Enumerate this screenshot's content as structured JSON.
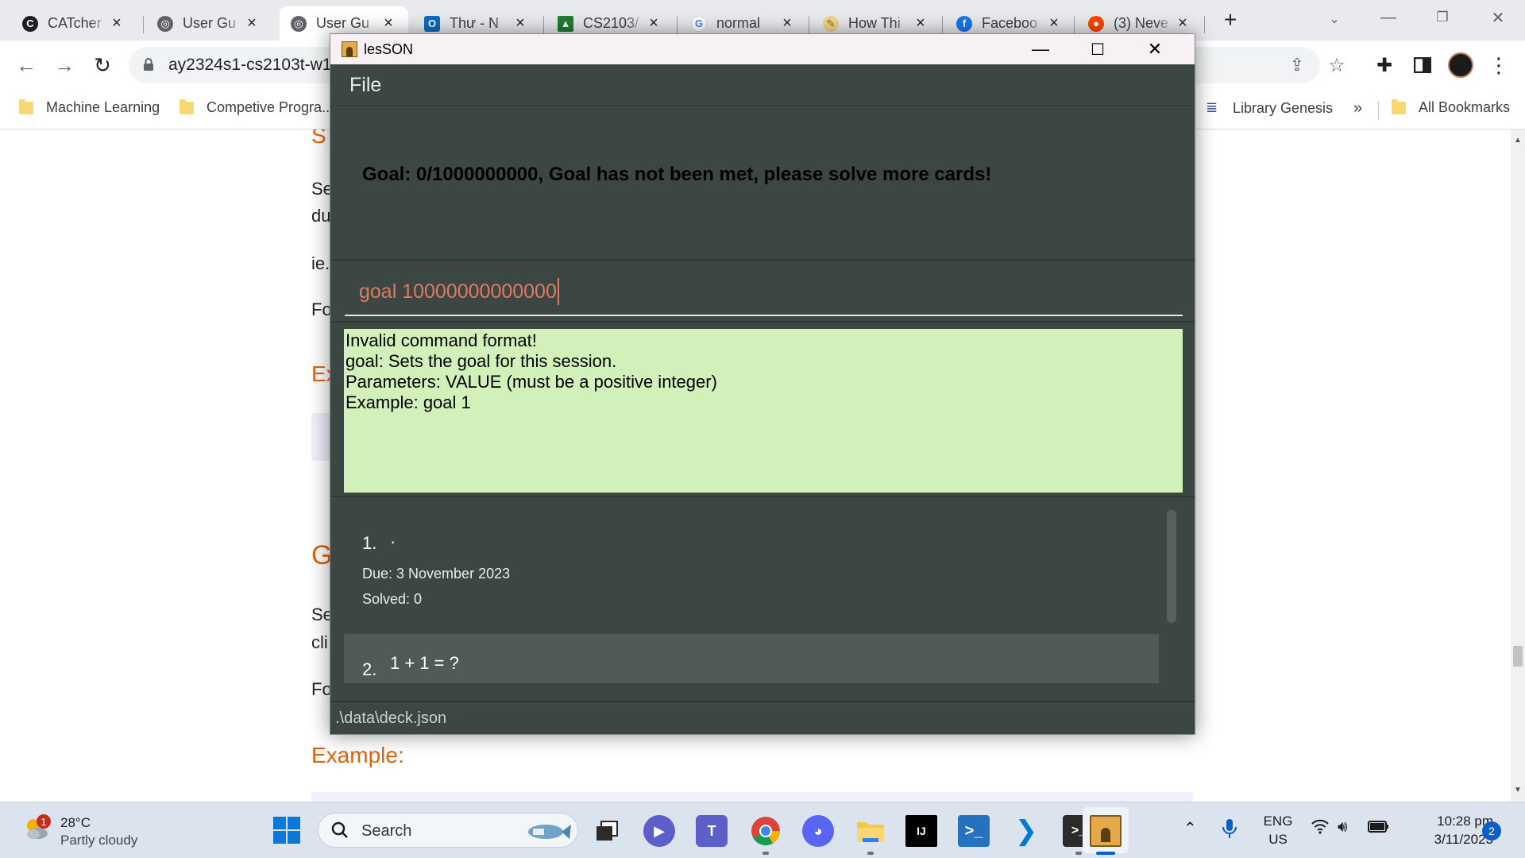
{
  "browser": {
    "tabs": [
      {
        "title": "CATcher",
        "icon": "catcher-icon",
        "color": "#1f1f1f"
      },
      {
        "title": "User Gu",
        "icon": "globe-icon",
        "color": "#5f6368"
      },
      {
        "title": "User Gu",
        "icon": "globe-icon",
        "color": "#5f6368",
        "active": true
      },
      {
        "title": "Thư - N",
        "icon": "outlook-icon",
        "color": "#0f6cbd"
      },
      {
        "title": "CS2103/",
        "icon": "graduation-cap-icon",
        "color": "#1e7e34"
      },
      {
        "title": "normal",
        "icon": "google-icon",
        "color": "#4285f4"
      },
      {
        "title": "How Thi",
        "icon": "feather-icon",
        "color": "#c8a02b"
      },
      {
        "title": "Faceboo",
        "icon": "facebook-icon",
        "color": "#1877f2"
      },
      {
        "title": "(3) Neve",
        "icon": "reddit-icon",
        "color": "#ff4500"
      }
    ],
    "new_tab": "+",
    "url": "ay2324s1-cs2103t-w1",
    "bookmarks": {
      "left": [
        {
          "label": "Machine Learning",
          "icon": "folder-icon"
        },
        {
          "label": "Competive Progra...",
          "icon": "folder-icon"
        }
      ],
      "library": "Library Genesis",
      "overflow": "»",
      "all": "All Bookmarks"
    }
  },
  "background_page": {
    "fragments": [
      {
        "text": "S",
        "kind": "heading"
      },
      {
        "text": "Se",
        "kind": "body"
      },
      {
        "text": "du",
        "kind": "body"
      },
      {
        "text": "ie.",
        "kind": "body"
      },
      {
        "text": "Fo",
        "kind": "body"
      },
      {
        "text": "Ex",
        "kind": "heading"
      },
      {
        "text": "G",
        "kind": "heading"
      },
      {
        "text": "Se",
        "kind": "body"
      },
      {
        "text": "cli",
        "kind": "body"
      },
      {
        "text": "Fo",
        "kind": "body"
      },
      {
        "text": "Example:",
        "kind": "heading"
      }
    ]
  },
  "app": {
    "title": "lesSON",
    "menu": [
      "File"
    ],
    "goal_message": "Goal: 0/1000000000, Goal has not been met, please solve more cards!",
    "command_input": "goal 10000000000000",
    "result_lines": [
      "Invalid command format!",
      "goal: Sets the goal for this session.",
      "Parameters: VALUE (must be a positive integer)",
      "Example: goal 1"
    ],
    "cards": [
      {
        "index": "1.",
        "question": "·",
        "due": "Due: 3 November 2023",
        "solved": "Solved: 0"
      },
      {
        "index": "2.",
        "question": "1 + 1 = ?"
      }
    ],
    "status_path": ".\\data\\deck.json"
  },
  "taskbar": {
    "weather": {
      "badge": "1",
      "temp": "28°C",
      "condition": "Partly cloudy"
    },
    "search_label": "Search",
    "apps": [
      {
        "name": "task-view-icon",
        "color": "#2b2b2b"
      },
      {
        "name": "zoom-icon",
        "color": "#5b5fc7"
      },
      {
        "name": "teams-icon",
        "color": "#5b5fc7"
      },
      {
        "name": "chrome-icon",
        "color": "#1a73e8"
      },
      {
        "name": "discord-icon",
        "color": "#5865f2"
      },
      {
        "name": "file-explorer-icon",
        "color": "#f2c94c"
      },
      {
        "name": "intellij-icon",
        "color": "#000000"
      },
      {
        "name": "powershell-icon",
        "color": "#2671be"
      },
      {
        "name": "vscode-icon",
        "color": "#0078d4"
      },
      {
        "name": "terminal-icon",
        "color": "#2b2b2b"
      },
      {
        "name": "lesson-app-icon",
        "color": "#e5a94a"
      }
    ],
    "language": [
      "ENG",
      "US"
    ],
    "time": "10:28 pm",
    "date": "3/11/2023",
    "notifications": "2"
  }
}
